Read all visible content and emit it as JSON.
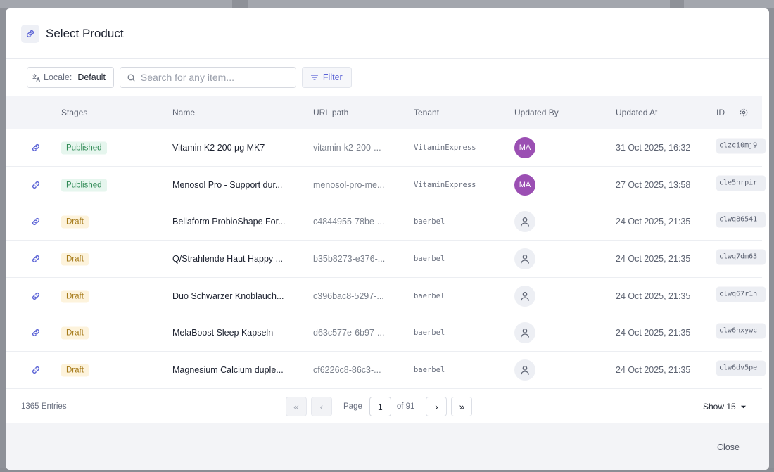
{
  "modal": {
    "title": "Select Product",
    "title_icon": "link-icon"
  },
  "toolbar": {
    "locale_label": "Locale:",
    "locale_value": "Default",
    "search_placeholder": "Search for any item...",
    "filter_label": "Filter"
  },
  "table": {
    "headers": {
      "stages": "Stages",
      "name": "Name",
      "url": "URL path",
      "tenant": "Tenant",
      "updated_by": "Updated By",
      "updated_at": "Updated At",
      "id": "ID"
    },
    "rows": [
      {
        "stage": "Published",
        "name": "Vitamin K2 200 µg MK7",
        "url": "vitamin-k2-200-...",
        "tenant": "VitaminExpress",
        "updated_by": "MA",
        "updated_at": "31 Oct 2025, 16:32",
        "id": "clzci0mj9"
      },
      {
        "stage": "Published",
        "name": "Menosol Pro - Support dur...",
        "url": "menosol-pro-me...",
        "tenant": "VitaminExpress",
        "updated_by": "MA",
        "updated_at": "27 Oct 2025, 13:58",
        "id": "cle5hrpir"
      },
      {
        "stage": "Draft",
        "name": "Bellaform ProbioShape For...",
        "url": "c4844955-78be-...",
        "tenant": "baerbel",
        "updated_by": "",
        "updated_at": "24 Oct 2025, 21:35",
        "id": "clwq86541"
      },
      {
        "stage": "Draft",
        "name": "Q/Strahlende Haut Happy ...",
        "url": "b35b8273-e376-...",
        "tenant": "baerbel",
        "updated_by": "",
        "updated_at": "24 Oct 2025, 21:35",
        "id": "clwq7dm63"
      },
      {
        "stage": "Draft",
        "name": "Duo Schwarzer Knoblauch...",
        "url": "c396bac8-5297-...",
        "tenant": "baerbel",
        "updated_by": "",
        "updated_at": "24 Oct 2025, 21:35",
        "id": "clwq67r1h"
      },
      {
        "stage": "Draft",
        "name": "MelaBoost Sleep Kapseln",
        "url": "d63c577e-6b97-...",
        "tenant": "baerbel",
        "updated_by": "",
        "updated_at": "24 Oct 2025, 21:35",
        "id": "clw6hxywc"
      },
      {
        "stage": "Draft",
        "name": "Magnesium Calcium duple...",
        "url": "cf6226c8-86c3-...",
        "tenant": "baerbel",
        "updated_by": "",
        "updated_at": "24 Oct 2025, 21:35",
        "id": "clw6dv5pe"
      }
    ]
  },
  "pagination": {
    "entries": "1365 Entries",
    "page_label": "Page",
    "current_page": "1",
    "of_label": "of 91",
    "show": "Show 15"
  },
  "footer": {
    "close_label": "Close"
  },
  "colors": {
    "accent": "#5b63d6",
    "published_bg": "#e6f6ee",
    "published_text": "#2f8a55",
    "draft_bg": "#fdf3dc",
    "draft_text": "#a67b1a",
    "avatar_ma": "#9b4fb3"
  }
}
